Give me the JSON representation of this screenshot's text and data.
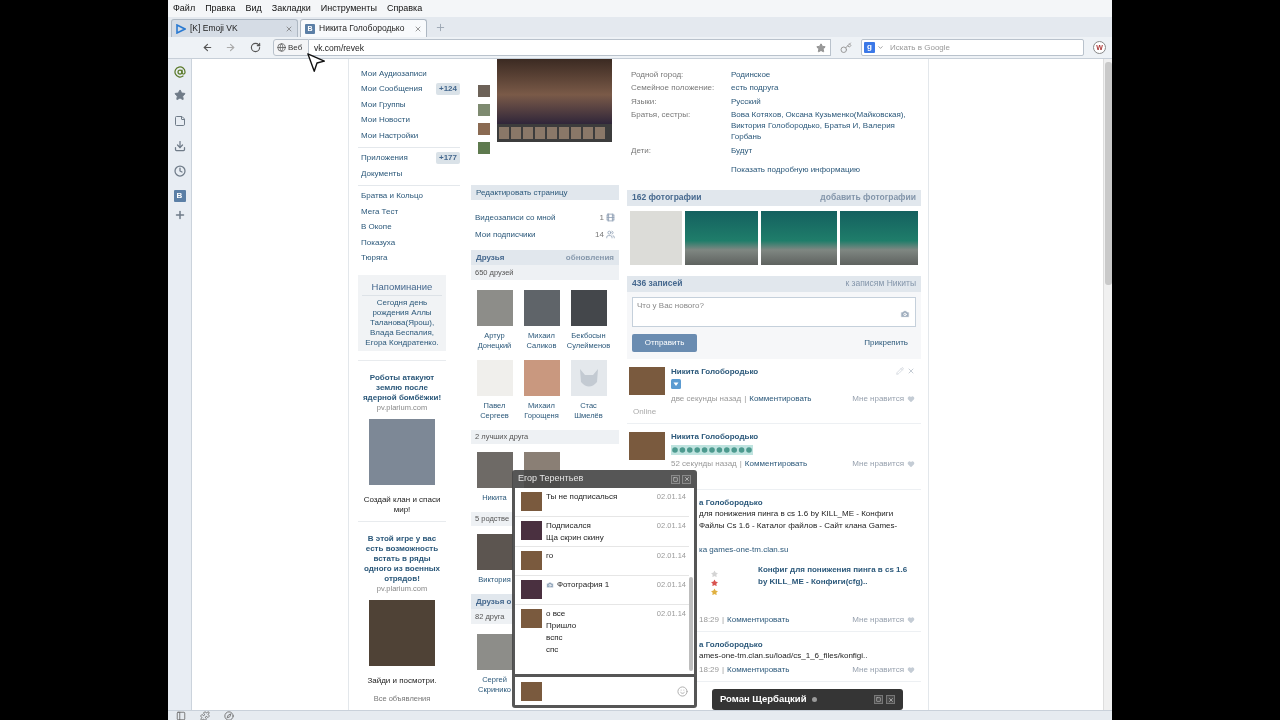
{
  "browser": {
    "menu": [
      "Файл",
      "Правка",
      "Вид",
      "Закладки",
      "Инструменты",
      "Справка"
    ],
    "tabs": [
      {
        "title": "[K] Emoji VK",
        "selected": false
      },
      {
        "title": "Никита Голобородько",
        "selected": true,
        "favicon_letter": "В"
      }
    ],
    "identity": "Веб",
    "url": "vk.com/revek",
    "search": {
      "engine_letter": "g",
      "placeholder": "Искать в Google"
    },
    "addon_letter": "W"
  },
  "sidebar": {
    "badge_letter": "В"
  },
  "left_menu": {
    "groups": [
      [
        {
          "label": "Мои Аудиозаписи"
        },
        {
          "label": "Мои Сообщения",
          "count": "+124"
        },
        {
          "label": "Мои Группы"
        },
        {
          "label": "Мои Новости"
        },
        {
          "label": "Мои Настройки"
        }
      ],
      [
        {
          "label": "Приложения",
          "count": "+177"
        },
        {
          "label": "Документы"
        }
      ],
      [
        {
          "label": "Братва и Кольцо"
        },
        {
          "label": "Мега Тест"
        },
        {
          "label": "В Окопе"
        },
        {
          "label": "Показуха"
        },
        {
          "label": "Тюряга"
        }
      ]
    ]
  },
  "reminder": {
    "title": "Напоминание",
    "text": "Сегодня день рождения Аллы Таланова(Ярош), Влада Беспалия, Егора Кондратенко."
  },
  "ads": {
    "items": [
      {
        "title": "Роботы атакуют землю после ядерной бомбёжки!",
        "domain": "pv.plarium.com",
        "caption": "Создай клан и спаси мир!",
        "kind": "robot"
      },
      {
        "title": "В этой игре у вас есть возможность встать в ряды одного из военных отрядов!",
        "domain": "pv.plarium.com",
        "caption": "Зайди и посмотри.",
        "kind": "fire"
      }
    ],
    "all": "Все объявления"
  },
  "profile": {
    "edit": "Редактировать страницу",
    "counters": [
      {
        "label": "Видеозаписи со мной",
        "count": "1",
        "kind": "video"
      },
      {
        "label": "Мои подписчики",
        "count": "14",
        "kind": "people"
      }
    ],
    "friend_blocks": [
      {
        "kind": "header",
        "title": "Друзья",
        "link": "обновления",
        "subtitle": "650 друзей",
        "people": [
          {
            "first": "Артур",
            "last": "Донецкий",
            "kind": "photo"
          },
          {
            "first": "Михаил",
            "last": "Саликов",
            "kind": "photo"
          },
          {
            "first": "Бекбосын",
            "last": "Сулейменов",
            "kind": "photo"
          },
          {
            "first": "Павел",
            "last": "Сергеев",
            "kind": "photo"
          },
          {
            "first": "Михаил",
            "last": "Горощеня",
            "kind": "photo"
          },
          {
            "first": "Стас",
            "last": "Шмелёв",
            "kind": "default"
          }
        ]
      },
      {
        "kind": "subheader",
        "title": "2 лучших друга",
        "people": [
          {
            "first": "Никита",
            "kind": "photo"
          },
          {
            "kind": "photo"
          }
        ]
      },
      {
        "kind": "subheader",
        "title": "5 родстве",
        "people": [
          {
            "first": "Виктория",
            "kind": "photo"
          }
        ]
      },
      {
        "kind": "header",
        "title": "Друзья о",
        "subtitle": "82 друга",
        "people": [
          {
            "first": "Сергей",
            "last": "Скринико",
            "kind": "photo"
          }
        ]
      }
    ]
  },
  "info": {
    "rows": [
      {
        "label": "Родной город:",
        "value": "Родинское"
      },
      {
        "label": "Семейное положение:",
        "value": "есть подруга"
      },
      {
        "label": "Языки:",
        "value": "Русский"
      },
      {
        "label": "Братья, сестры:",
        "value": "Вова Котяхов, Оксана Кузьменко(Майковская), Виктория Голобородько, Братья И, Валерия Горбань"
      },
      {
        "label": "Дети:",
        "value": "Будут"
      }
    ],
    "more": "Показать подробную информацию"
  },
  "photos": {
    "title": "162 фотографии",
    "link": "добавить фотографии",
    "thumbs": [
      {
        "kind": "document"
      },
      {
        "kind": "aquarium"
      },
      {
        "kind": "aquarium"
      },
      {
        "kind": "aquarium"
      }
    ]
  },
  "wall": {
    "title": "436 записей",
    "link": "к записям Никиты",
    "composer": {
      "placeholder": "Что у Вас нового?"
    },
    "submit": "Отправить",
    "attach": "Прикрепить",
    "posts": [
      {
        "kind": "emoji",
        "author": "Никита Голобородько",
        "time": "две секунды назад",
        "separator": "|",
        "comment": "Комментировать",
        "like": "Мне нравится",
        "status": "Online",
        "show_actions": true
      },
      {
        "kind": "emoji_row",
        "author": "Никита Голобородько",
        "time": "52 секунды назад",
        "separator": "|",
        "comment": "Комментировать",
        "like": "Мне нравится",
        "show_actions": false
      },
      {
        "kind": "link",
        "author": "а Голобородько",
        "lines": [
          "для понижения пинга в cs 1.6 by KILL_ME - Конфиги",
          "Файлы Cs 1.6 - Каталог файлов - Сайт клана Games-"
        ],
        "source": "ка games-one-tm.clan.su",
        "attachment": "Конфиг для понижения пинга в cs 1.6 by KILL_ME - Конфиги(cfg)..",
        "time": "18:29",
        "separator": "|",
        "comment": "Комментировать",
        "like": "Мне нравится",
        "show_actions": false
      },
      {
        "kind": "text",
        "author": "а Голобородько",
        "lines": [
          "ames-one-tm.clan.su/load/cs_1_6_files/konfigi.."
        ],
        "time": "18:29",
        "separator": "|",
        "comment": "Комментировать",
        "like": "Мне нравится",
        "show_actions": false
      }
    ]
  },
  "chat": {
    "title": "Егор Терентьев",
    "messages": [
      {
        "outgoing": true,
        "kind": "text",
        "lines": [
          "Ты не подписалься"
        ],
        "date": "02.01.14"
      },
      {
        "outgoing": false,
        "kind": "text",
        "lines": [
          "Подписался",
          "Ща скрин скину"
        ],
        "date": "02.01.14"
      },
      {
        "outgoing": true,
        "kind": "text",
        "lines": [
          "го"
        ],
        "date": "02.01.14"
      },
      {
        "outgoing": false,
        "kind": "photo",
        "lines": [
          "Фотография 1"
        ],
        "date": "02.01.14"
      },
      {
        "outgoing": true,
        "kind": "text",
        "lines": [
          "о все",
          "Пришло",
          "вспс",
          "спс"
        ],
        "date": "02.01.14"
      }
    ]
  },
  "chat_tabs": [
    {
      "title": "Роман Щербацкий",
      "online": true
    }
  ]
}
